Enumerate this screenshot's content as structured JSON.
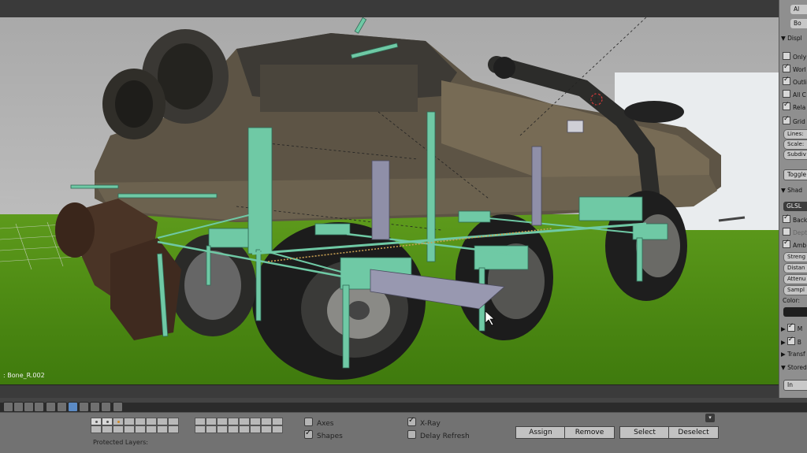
{
  "viewport": {
    "object_label": ": Bone_R.002"
  },
  "properties_panel": {
    "top_field_1": "Al",
    "top_field_2": "Bo",
    "display_header": "Displ",
    "display_rows": [
      {
        "label": "Only",
        "checked": false
      },
      {
        "label": "Worl",
        "checked": true
      },
      {
        "label": "Outli",
        "checked": true
      },
      {
        "label": "All C",
        "checked": false
      },
      {
        "label": "Rela",
        "checked": true
      },
      {
        "label": "Grid",
        "checked": true
      }
    ],
    "grid_fields": [
      "Lines:",
      "Scale:",
      "Subdiv"
    ],
    "toggle_label": "Toggle",
    "shading_header": "Shad",
    "shading_mode": "GLSL",
    "shading_rows": [
      {
        "label": "Back",
        "checked": true
      },
      {
        "label": "Dept",
        "checked": false
      },
      {
        "label": "Amb",
        "checked": true
      }
    ],
    "ao_fields": [
      "Streng",
      "Distan",
      "Attenu",
      "Sampl"
    ],
    "color_label": "Color:",
    "collapsed_headers": [
      "M",
      "B",
      "Transf",
      "Stored"
    ],
    "bottom_button": "In"
  },
  "bone_layers": {
    "axes_label": "Axes",
    "axes_checked": false,
    "shapes_label": "Shapes",
    "shapes_checked": true,
    "xray_label": "X-Ray",
    "xray_checked": true,
    "delay_label": "Delay Refresh",
    "delay_checked": false,
    "buttons": [
      "Assign",
      "Remove",
      "Select",
      "Deselect"
    ],
    "protected_label": "Protected Layers:"
  },
  "colors": {
    "bone_green": "#6fc9a5",
    "bone_gray": "#8f8fa8",
    "ground": "#4f8c14",
    "active_tool": "#5b8ac4"
  }
}
